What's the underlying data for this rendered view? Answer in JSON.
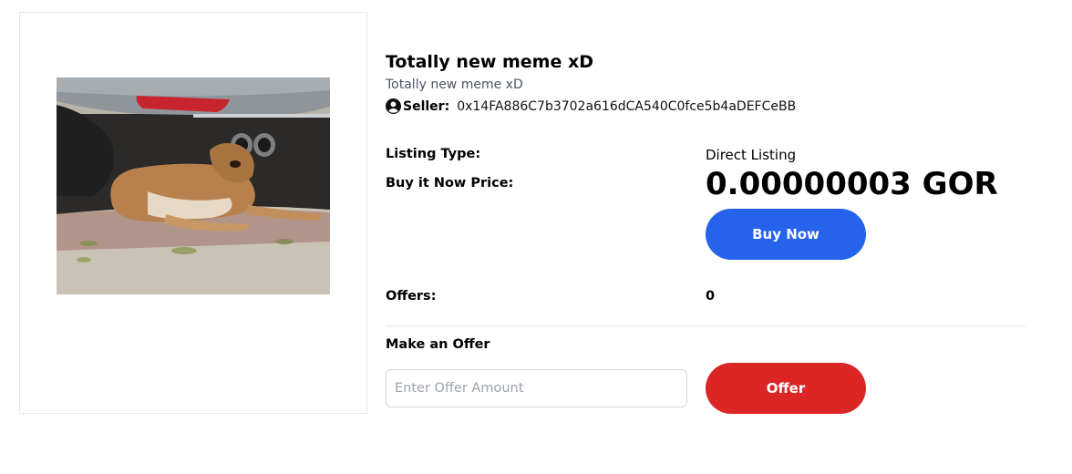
{
  "listing": {
    "title": "Totally new meme xD",
    "description": "Totally new meme xD",
    "seller_label": "Seller:",
    "seller_address": "0x14FA886C7b3702a616dCA540C0fce5b4aDEFCeBB"
  },
  "details": {
    "listing_type_label": "Listing Type:",
    "listing_type_value": "Direct Listing",
    "price_label": "Buy it Now Price:",
    "price_value": "0.00000003 GOR",
    "buy_button_label": "Buy Now",
    "offers_label": "Offers:",
    "offers_count": "0"
  },
  "offer_form": {
    "heading": "Make an Offer",
    "input_placeholder": "Enter Offer Amount",
    "input_value": "",
    "submit_label": "Offer"
  },
  "colors": {
    "buy_button": "#2563eb",
    "offer_button": "#dc2626"
  },
  "icons": {
    "seller": "user-circle-icon"
  }
}
